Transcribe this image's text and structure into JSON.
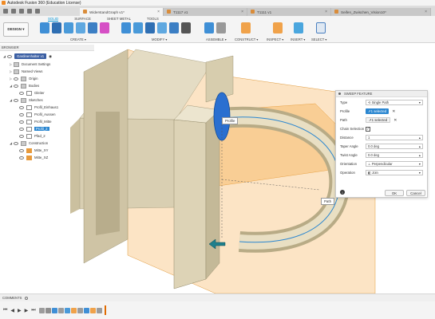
{
  "app": {
    "title": "Autodesk Fusion 360 (Education License)"
  },
  "tabs": [
    {
      "label": "WiderstandGraph v1*",
      "active": true
    },
    {
      "label": "T1117 v1",
      "active": false
    },
    {
      "label": "T1111 v1",
      "active": false
    },
    {
      "label": "Seifen_Zwischen_Vision10*",
      "active": false
    }
  ],
  "toolbar": {
    "workspace": "DESIGN ▾",
    "ribbon_tabs": [
      "SOLID",
      "SURFACE",
      "SHEET METAL",
      "TOOLS"
    ],
    "groups": [
      "CREATE ▾",
      "MODIFY ▾",
      "ASSEMBLE ▾",
      "CONSTRUCT ▾",
      "INSPECT ▾",
      "INSERT ▾",
      "SELECT ▾"
    ]
  },
  "browser": {
    "header": "BROWSER",
    "component": "Gardinenhalter v1",
    "items": {
      "doc_settings": "Document Settings",
      "named_views": "Named Views",
      "origin": "Origin",
      "bodies": "Bodies",
      "body1": "Gleiter",
      "sketches": "Sketches",
      "s1": "Profil_Einhaus1",
      "s2": "Profil_Aussen",
      "s3": "Profil_Mitte",
      "s4": "Profil_2",
      "s5": "Pfad_2",
      "construction": "Construction",
      "p1": "Mitte_XY",
      "p2": "Mitte_XZ"
    }
  },
  "viewport": {
    "label_profile": "Profile",
    "label_path": "Path"
  },
  "dialog": {
    "title": "SWEEP FEATURE",
    "rows": {
      "type": {
        "label": "Type",
        "value": "Single Path"
      },
      "profile": {
        "label": "Profile",
        "value": "1 selected"
      },
      "path": {
        "label": "Path",
        "value": "1 selected"
      },
      "chain": {
        "label": "Chain Selection",
        "value": "✓"
      },
      "distance": {
        "label": "Distance",
        "value": "1"
      },
      "taper": {
        "label": "Taper Angle",
        "value": "0.0 deg"
      },
      "twist": {
        "label": "Twist Angle",
        "value": "0.0 deg"
      },
      "orientation": {
        "label": "Orientation",
        "value": "Perpendicular"
      },
      "operation": {
        "label": "Operation",
        "value": "Join"
      }
    },
    "ok": "OK",
    "cancel": "Cancel"
  },
  "comments": {
    "label": "COMMENTS"
  },
  "colors": {
    "accent": "#0696d7",
    "select": "#2a86d0",
    "plane": "#f5a623",
    "body": "#d8cfb5"
  }
}
